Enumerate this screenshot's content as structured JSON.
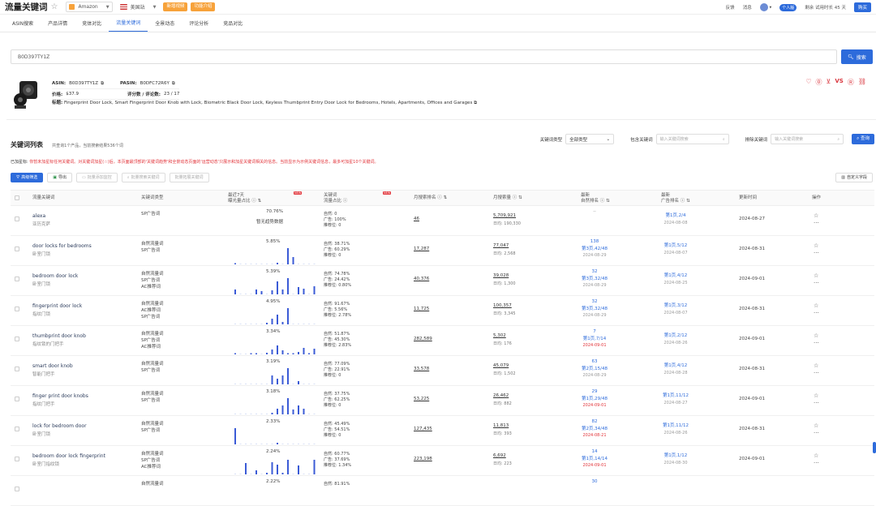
{
  "header": {
    "title": "流量关键词",
    "marketplace": "Amazon",
    "site": "美国站",
    "btn1": "新增视频",
    "btn2": "功能介绍",
    "feedback": "反馈",
    "messages": "消息",
    "user_tag": "个人版",
    "expiry": "剩余 试用时长 45 天",
    "buy": "购买"
  },
  "tabs": [
    "ASIN搜索",
    "产品详情",
    "竞体对比",
    "流量关键词",
    "全景动态",
    "评论分析",
    "竞品对比"
  ],
  "search": {
    "value": "B0D397TY1Z",
    "button": "搜索"
  },
  "product": {
    "asin_label": "ASIN:",
    "asin": "B0D397TY1Z",
    "pasin_label": "PASIN:",
    "pasin": "B0DFC72R6Y",
    "price_label": "价格:",
    "price": "$37.9",
    "rating_label": "评分数 / 评论数:",
    "rating": "23 / 17",
    "title_label": "标题:",
    "title": "Fingerprint Door Lock, Smart Fingerprint Door Knob with Lock, Biometric Black Door Lock, Keyless Thumbprint Entry Door Lock for Bedrooms, Hotels, Apartments, Offices and Garages"
  },
  "keyword_list": {
    "title": "关键词列表",
    "subtitle": "共查询1个产品，当前搜索结果536个词",
    "type_label": "关键词类型",
    "type_value": "全部类型",
    "include_label": "包含关键词",
    "include_placeholder": "输入关键词搜索",
    "exclude_label": "排除关键词",
    "exclude_placeholder": "输入关键词搜索",
    "query_button": "查询"
  },
  "notice": {
    "prefix": "已加星标:",
    "text": "你暂未加星标任何关键词。对关键词加星(☆)后，本页面最顶部的'关键词趋势'和全景动态页面的'运营动态'只展示和加星关键词相关的信息。当前显示为示例关键词信息，最多可加星10个关键词。"
  },
  "actions": {
    "filter": "高级筛选",
    "export": "导出",
    "add_monitor": "批量添加监控",
    "search_related": "批量搜索关键词",
    "expand": "批量拓展关键词",
    "custom_fields": "自定义字段"
  },
  "columns": {
    "keyword": "流量关键词",
    "type": "关键词类型",
    "pct_l1": "最近7天",
    "pct_l2": "曝光量占比",
    "share_l1": "关键词",
    "share_l2": "流量占比",
    "new": "NEW",
    "monthly_search": "月搜索排名",
    "monthly_volume": "月搜索量",
    "nat_l1": "最新",
    "nat_l2": "自然排名",
    "ad_l1": "最新",
    "ad_l2": "广告排名",
    "date": "更新时间",
    "ops": "操作"
  },
  "rows": [
    {
      "kw": "alexa",
      "cn": "亚历克萨",
      "types": [
        "SP广告词"
      ],
      "pct": "70.76%",
      "nodata": "暂无趋势数据",
      "bars": [],
      "share": [
        "自然: 0",
        "广告: 100%",
        "推荐位: 0"
      ],
      "search_rank": "46",
      "volume": "5,709,921",
      "daily": "日均: 190,330",
      "rank": [
        "--"
      ],
      "ad": [
        "第1页,2/4",
        "2024-08-08"
      ],
      "date": "2024-08-27"
    },
    {
      "kw": "door locks for bedrooms",
      "cn": "卧室门锁",
      "types": [
        "自然流量词",
        "SP广告词"
      ],
      "pct": "5.85%",
      "bars": [
        0.05,
        0,
        0,
        0,
        0,
        0,
        0,
        0,
        0.1,
        0,
        1,
        0.45,
        0,
        0,
        0,
        0
      ],
      "share": [
        "自然: 38.71%",
        "广告: 60.29%",
        "推荐位: 0"
      ],
      "search_rank": "17,287",
      "volume": "77,047",
      "daily": "日均: 2,568",
      "rank": [
        "138",
        "第3页,42/48",
        "2024-08-29"
      ],
      "ad": [
        "第1页,5/12",
        "2024-08-07"
      ],
      "date": "2024-08-31"
    },
    {
      "kw": "bedroom door lock",
      "cn": "卧室门锁",
      "types": [
        "自然流量词",
        "SP广告词",
        "AC推荐词"
      ],
      "pct": "5.39%",
      "bars": [
        0.3,
        0,
        0,
        0,
        0.3,
        0.2,
        0,
        0.25,
        0.8,
        0.3,
        1,
        0,
        0.45,
        0.35,
        0,
        0.5
      ],
      "share": [
        "自然: 74.78%",
        "广告: 24.42%",
        "推荐位: 0.80%"
      ],
      "search_rank": "40,376",
      "volume": "39,028",
      "daily": "日均: 1,300",
      "rank": [
        "32",
        "第3页,32/48",
        "2024-08-29"
      ],
      "ad": [
        "第1页,4/12",
        "2024-08-25"
      ],
      "date": "2024-09-01"
    },
    {
      "kw": "fingerprint door lock",
      "cn": "指纹门锁",
      "types": [
        "自然流量词",
        "AC推荐词",
        "SP广告词"
      ],
      "pct": "4.95%",
      "bars": [
        0,
        0,
        0,
        0,
        0,
        0,
        0.1,
        0.35,
        0.6,
        0.15,
        1,
        0,
        0,
        0,
        0,
        0
      ],
      "share": [
        "自然: 91.67%",
        "广告: 5.56%",
        "推荐位: 2.78%"
      ],
      "search_rank": "11,725",
      "volume": "100,357",
      "daily": "日均: 3,345",
      "rank": [
        "32",
        "第3页,32/48",
        "2024-08-29"
      ],
      "ad": [
        "第1页,3/12",
        "2024-08-07"
      ],
      "date": "2024-08-31"
    },
    {
      "kw": "thumbprint door knob",
      "cn": "指纹锁的门把手",
      "types": [
        "自然流量词",
        "SP广告词",
        "AC推荐词"
      ],
      "pct": "3.34%",
      "bars": [
        0.05,
        0,
        0,
        0.05,
        0.05,
        0,
        0.1,
        0.3,
        0.55,
        0.25,
        0.05,
        0.05,
        0.15,
        0.4,
        0.05,
        0.35
      ],
      "share": [
        "自然: 51.87%",
        "广告: 45.30%",
        "推荐位: 2.83%"
      ],
      "search_rank": "282,589",
      "volume": "5,302",
      "daily": "日均: 176",
      "rank": [
        "7",
        "第1页,7/14",
        "2024-09-01"
      ],
      "ad": [
        "第1页,2/12",
        "2024-08-26"
      ],
      "date": "2024-09-01"
    },
    {
      "kw": "smart door knob",
      "cn": "智能门把手",
      "types": [
        "自然流量词",
        "SP广告词"
      ],
      "pct": "3.19%",
      "bars": [
        0,
        0,
        0,
        0,
        0,
        0,
        0,
        0.55,
        0.35,
        0.55,
        1,
        0,
        0.2,
        0,
        0,
        0
      ],
      "share": [
        "自然: 77.09%",
        "广告: 22.91%",
        "推荐位: 0"
      ],
      "search_rank": "33,578",
      "volume": "45,079",
      "daily": "日均: 1,502",
      "rank": [
        "63",
        "第2页,15/48",
        "2024-08-29"
      ],
      "ad": [
        "第1页,4/12",
        "2024-08-28"
      ],
      "date": "2024-08-31"
    },
    {
      "kw": "finger print door knobs",
      "cn": "指纹门把手",
      "types": [
        "自然流量词",
        "SP广告词"
      ],
      "pct": "3.18%",
      "bars": [
        0,
        0,
        0,
        0,
        0,
        0,
        0,
        0.1,
        0.35,
        0.55,
        1,
        0.3,
        0.55,
        0.35,
        0,
        0
      ],
      "share": [
        "自然: 37.75%",
        "广告: 62.25%",
        "推荐位: 0"
      ],
      "search_rank": "53,225",
      "volume": "26,462",
      "daily": "日均: 882",
      "rank": [
        "29",
        "第1页,29/48",
        "2024-09-01"
      ],
      "ad": [
        "第1页,11/12",
        "2024-08-27"
      ],
      "date": "2024-09-01"
    },
    {
      "kw": "lock for bedroom door",
      "cn": "卧室门锁",
      "types": [
        "自然流量词",
        "SP广告词"
      ],
      "pct": "2.33%",
      "bars": [
        1,
        0,
        0,
        0,
        0,
        0,
        0,
        0,
        0.1,
        0,
        0,
        0,
        0,
        0,
        0,
        0
      ],
      "share": [
        "自然: 45.49%",
        "广告: 54.51%",
        "推荐位: 0"
      ],
      "search_rank": "127,435",
      "volume": "11,813",
      "daily": "日均: 393",
      "rank": [
        "82",
        "第2页,34/48",
        "2024-08-21"
      ],
      "ad": [
        "第1页,11/12",
        "2024-08-26"
      ],
      "date": "2024-08-31"
    },
    {
      "kw": "bedroom door lock fingerprint",
      "cn": "卧室门指纹锁",
      "types": [
        "自然流量词",
        "SP广告词",
        "AC推荐词"
      ],
      "pct": "2.24%",
      "bars": [
        0,
        0,
        0.7,
        0,
        0.25,
        0,
        0.1,
        0.75,
        0.6,
        0.1,
        0.9,
        0,
        0.55,
        0,
        0,
        0.9
      ],
      "share": [
        "自然: 60.77%",
        "广告: 37.69%",
        "推荐位: 1.34%"
      ],
      "search_rank": "223,198",
      "volume": "6,692",
      "daily": "日均: 223",
      "rank": [
        "14",
        "第1页,14/14",
        "2024-09-01"
      ],
      "ad": [
        "第1页,1/12",
        "2024-08-30"
      ],
      "date": "2024-09-01"
    },
    {
      "kw": "",
      "cn": "",
      "types": [
        "自然流量词"
      ],
      "pct": "2.22%",
      "bars": [],
      "share": [
        "自然: 81.91%"
      ],
      "search_rank": "",
      "volume": "",
      "daily": "",
      "rank": [
        "30"
      ],
      "ad": [],
      "date": ""
    }
  ]
}
